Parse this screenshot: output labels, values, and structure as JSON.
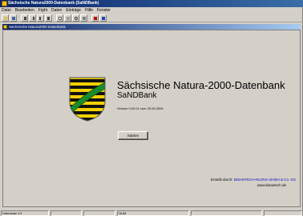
{
  "window": {
    "title": "Sächsische Natura2000-Datenbank (SaNDBank)"
  },
  "menubar": {
    "items": [
      "Datei",
      "Bearbeiten",
      "Fight",
      "Daten",
      "Einträge",
      "Hilfe",
      "Fenster"
    ]
  },
  "toolbar": {
    "buttons": [
      "open-icon",
      "save-icon",
      "first-icon",
      "prev-icon",
      "next-icon",
      "last-icon",
      "new-icon",
      "delete-icon",
      "search-icon",
      "print-icon",
      "help-icon",
      "exit-icon"
    ]
  },
  "mdi": {
    "title": "Sächsische Natura2000 Datenbank"
  },
  "splash": {
    "title": "Sächsische Natura-2000-Datenbank",
    "subtitle": "SaNDBank",
    "version": "Version 0.00.01 vom 20.05.2004",
    "start_label": "Starten",
    "credit_prefix": "Erstellt durch:",
    "credit_company": "BISANTECH-NUOVA GmbH & Co. KG",
    "credit_url": "www.bisantech.de"
  },
  "statusbar": {
    "cells": [
      "Datensatz 1/1",
      "",
      "",
      "NUM",
      "",
      ""
    ]
  },
  "colors": {
    "titlebar": "#0a246a",
    "face": "#d4d0c8",
    "link": "#0000c0"
  }
}
